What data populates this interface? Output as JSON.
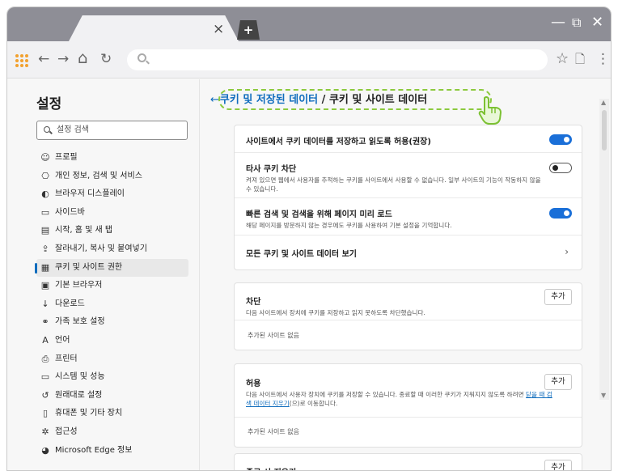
{
  "window": {
    "tab_close": "×",
    "new_tab": "+",
    "minimize": "—",
    "restore": "⧉",
    "close": "✕"
  },
  "toolbar": {
    "back": "←",
    "forward": "→",
    "home": "⌂",
    "refresh": "↻",
    "favorite": "☆",
    "collections": "🗋",
    "menu": "⋮",
    "address_value": ""
  },
  "sidebar": {
    "title": "설정",
    "search_placeholder": "설정 검색",
    "items": [
      {
        "icon": "profile-icon",
        "glyph": "☺",
        "label": "프로필"
      },
      {
        "icon": "lock-icon",
        "glyph": "⎔",
        "label": "개인 정보, 검색 및 서비스"
      },
      {
        "icon": "appearance-icon",
        "glyph": "◐",
        "label": "브라우저 디스플레이"
      },
      {
        "icon": "sidebar-icon",
        "glyph": "▭",
        "label": "사이드바"
      },
      {
        "icon": "start-home-icon",
        "glyph": "▤",
        "label": "시작, 홈 및 새 탭"
      },
      {
        "icon": "share-icon",
        "glyph": "⇪",
        "label": "잘라내기, 복사 및 붙여넣기"
      },
      {
        "icon": "cookies-icon",
        "glyph": "▦",
        "label": "쿠키 및 사이트 권한"
      },
      {
        "icon": "default-browser-icon",
        "glyph": "▣",
        "label": "기본 브라우저"
      },
      {
        "icon": "download-icon",
        "glyph": "↓",
        "label": "다운로드"
      },
      {
        "icon": "family-icon",
        "glyph": "⚭",
        "label": "가족 보호 설정"
      },
      {
        "icon": "language-icon",
        "glyph": "A",
        "label": "언어"
      },
      {
        "icon": "printer-icon",
        "glyph": "⎙",
        "label": "프린터"
      },
      {
        "icon": "system-icon",
        "glyph": "▭",
        "label": "시스템 및 성능"
      },
      {
        "icon": "reset-icon",
        "glyph": "↺",
        "label": "원래대로 설정"
      },
      {
        "icon": "phone-icon",
        "glyph": "▯",
        "label": "휴대폰 및 기타 장치"
      },
      {
        "icon": "accessibility-icon",
        "glyph": "✲",
        "label": "접근성"
      },
      {
        "icon": "edge-icon",
        "glyph": "◕",
        "label": "Microsoft Edge 정보"
      }
    ],
    "active_index": 6
  },
  "content": {
    "breadcrumb": {
      "back": "←",
      "parent": "쿠키 및 저장된 데이터",
      "separator": " / ",
      "current": "쿠키 및 사이트 데이터"
    },
    "main_card": {
      "rows": [
        {
          "title": "사이트에서 쿠키 데이터를 저장하고 읽도록 허용(권장)",
          "desc": "",
          "toggle": "on"
        },
        {
          "title": "타사 쿠키 차단",
          "desc": "켜져 있으면 웹에서 사용자를 추적하는 쿠키를 사이트에서 사용할 수 없습니다. 일부 사이트의 기능이 작동하지 않을 수 있습니다.",
          "toggle": "off"
        },
        {
          "title": "빠른 검색 및 검색을 위해 페이지 미리 로드",
          "desc": "해당 페이지를 방문하지 않는 경우에도 쿠키를 사용하여 기본 설정을 기억합니다.",
          "toggle": "on"
        },
        {
          "title": "모든 쿠키 및 사이트 데이터 보기",
          "desc": "",
          "chevron": "›"
        }
      ]
    },
    "block_card": {
      "title": "차단",
      "desc": "다음 사이트에서 장치에 쿠키를 저장하고 읽지 못하도록 차단했습니다.",
      "add_label": "추가",
      "empty": "추가된 사이트 없음"
    },
    "allow_card": {
      "title": "허용",
      "desc_before": "다음 사이트에서 사용자 장치에 쿠키를 저장할 수 있습니다. 종료할 때 이러한 쿠키가 지워지지 않도록 하려면 ",
      "desc_link": "닫을 때 검색 데이터 지우기",
      "desc_after": "(으)로 이동합니다.",
      "add_label": "추가",
      "empty": "추가된 사이트 없음"
    },
    "clear_card": {
      "title": "종료 시 지우기",
      "add_label": "추가"
    },
    "scroll_up": "▲",
    "scroll_down": "▼"
  },
  "colors": {
    "accent": "#0f6cbd",
    "toggle_on": "#1a6fd8",
    "highlight_dash": "#8cca3e",
    "titlebar": "#8e8e96"
  }
}
